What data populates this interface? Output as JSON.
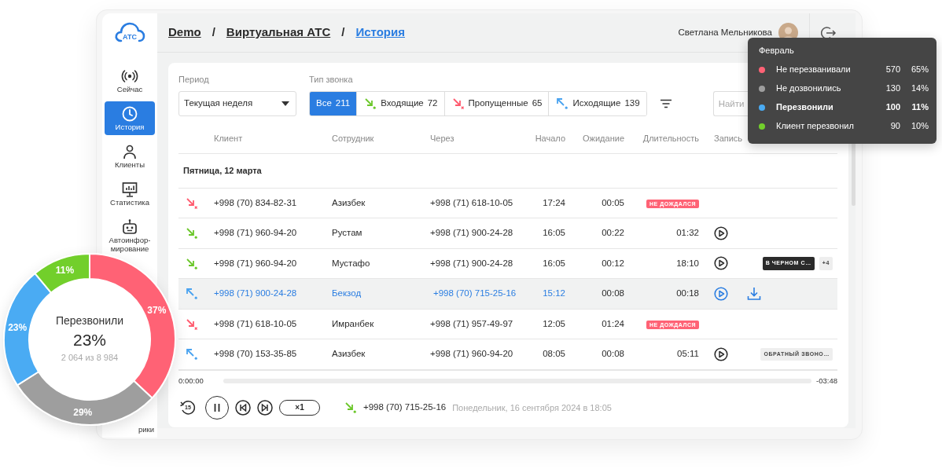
{
  "sidebar": {
    "logo_text": "АТС",
    "items": [
      {
        "label": "Сейчас",
        "selected": false
      },
      {
        "label": "История",
        "selected": true
      },
      {
        "label": "Клиенты",
        "selected": false
      },
      {
        "label": "Статистика",
        "selected": false
      },
      {
        "label": "Автоинфор-мирование",
        "selected": false
      },
      {
        "label": "рики",
        "selected": false
      }
    ]
  },
  "header": {
    "breadcrumbs": [
      {
        "kind": "crumb",
        "label": "Demo",
        "current": false
      },
      {
        "kind": "separator",
        "label": "/"
      },
      {
        "kind": "crumb",
        "label": "Виртуальная АТС",
        "current": false
      },
      {
        "kind": "separator",
        "label": "/"
      },
      {
        "kind": "crumb",
        "label": "История",
        "current": true
      }
    ],
    "user": {
      "name": "Светлана Мельникова"
    }
  },
  "filters": {
    "period": {
      "label": "Период",
      "value": "Текущая неделя"
    },
    "call_type": {
      "label": "Тип звонка",
      "options": [
        {
          "kind": "all",
          "label": "Все",
          "count": "211",
          "selected": true
        },
        {
          "kind": "incoming",
          "label": "Входящие",
          "count": "72",
          "selected": false
        },
        {
          "kind": "missed",
          "label": "Пропущенные",
          "count": "65",
          "selected": false
        },
        {
          "kind": "outgoing",
          "label": "Исходящие",
          "count": "139",
          "selected": false
        }
      ]
    },
    "search": {
      "placeholder": "Найти"
    }
  },
  "table": {
    "columns": [
      "Клиент",
      "Сотрудник",
      "Через",
      "Начало",
      "Ожидание",
      "Длительность",
      "Запись"
    ],
    "groups": [
      {
        "date": "Пятница, 12 марта",
        "rows": [
          {
            "kind": "missed",
            "client": "+998 (70) 834-82-31",
            "employee": "Азизбек",
            "via": "+998 (71) 618-10-05",
            "start": "17:24",
            "wait": "00:05",
            "status": "НЕ ДОЖДАЛСЯ",
            "record": false,
            "download": false,
            "selected": false
          },
          {
            "kind": "incoming",
            "client": "+998 (71) 960-94-20",
            "employee": "Рустам",
            "via": "+998 (71) 900-24-28",
            "start": "16:05",
            "wait": "00:22",
            "duration": "01:32",
            "record": true,
            "download": false,
            "selected": false
          },
          {
            "kind": "incoming",
            "client": "+998 (71) 960-94-20",
            "employee": "Мустафо",
            "via": "+998 (71) 900-24-28",
            "start": "16:05",
            "wait": "00:12",
            "duration": "18:10",
            "record": true,
            "download": false,
            "selected": false,
            "tags": [
              {
                "kind": "dark",
                "label": "В ЧЕРНОМ С…"
              },
              {
                "kind": "count",
                "label": "+4"
              }
            ]
          },
          {
            "kind": "outgoing",
            "client": "+998 (71) 900-24-28",
            "employee": "Бекзод",
            "via": "+998 (70) 715-25-16",
            "start": "15:12",
            "wait": "00:08",
            "duration": "00:18",
            "record": true,
            "download": true,
            "selected": true
          },
          {
            "kind": "missed",
            "client": "+998 (71) 618-10-05",
            "employee": "Имранбек",
            "via": "+998 (71) 957-49-97",
            "start": "12:05",
            "wait": "01:24",
            "status": "НЕ ДОЖДАЛСЯ",
            "record": false,
            "download": false,
            "selected": false
          },
          {
            "kind": "outgoing",
            "client": "+998 (70) 153-35-85",
            "employee": "Азизбек",
            "via": "+998 (71) 960-94-20",
            "start": "08:05",
            "wait": "00:08",
            "duration": "05:11",
            "record": true,
            "download": false,
            "selected": false,
            "tags": [
              {
                "kind": "light",
                "label": "ОБРАТНЫЙ ЗВОНО…"
              }
            ]
          }
        ]
      }
    ]
  },
  "player": {
    "elapsed": "0:00:00",
    "remaining": "-03:48",
    "rewind": "15",
    "playing": true,
    "speed": "×1",
    "call": {
      "kind": "incoming",
      "number": "+998 (70) 715-25-16",
      "date": "Понедельник, 16 сентября 2024 в 18:05"
    }
  },
  "donut": {
    "title": "Перезвонили",
    "value": "23%",
    "detail": "2 064 из 8 984",
    "chart_data": {
      "type": "donut",
      "values": [
        37,
        29,
        23,
        11
      ],
      "colors": [
        "#ff6275",
        "#9e9e9e",
        "#4aabf3",
        "#72cf2b"
      ],
      "value_labels": [
        "37%",
        "29%",
        "23%",
        "11%"
      ]
    }
  },
  "tooltip": {
    "title": "Февраль",
    "rows": [
      {
        "label": "Не перезванивали",
        "count": "570",
        "percent": "65%",
        "color": "#ff6275",
        "selected": false
      },
      {
        "label": "Не дозвонились",
        "count": "130",
        "percent": "14%",
        "color": "#9e9e9e",
        "selected": false
      },
      {
        "label": "Перезвонили",
        "count": "100",
        "percent": "11%",
        "color": "#4aabf3",
        "selected": true
      },
      {
        "label": "Клиент перезвонил",
        "count": "90",
        "percent": "10%",
        "color": "#72cf2b",
        "selected": false
      }
    ]
  }
}
